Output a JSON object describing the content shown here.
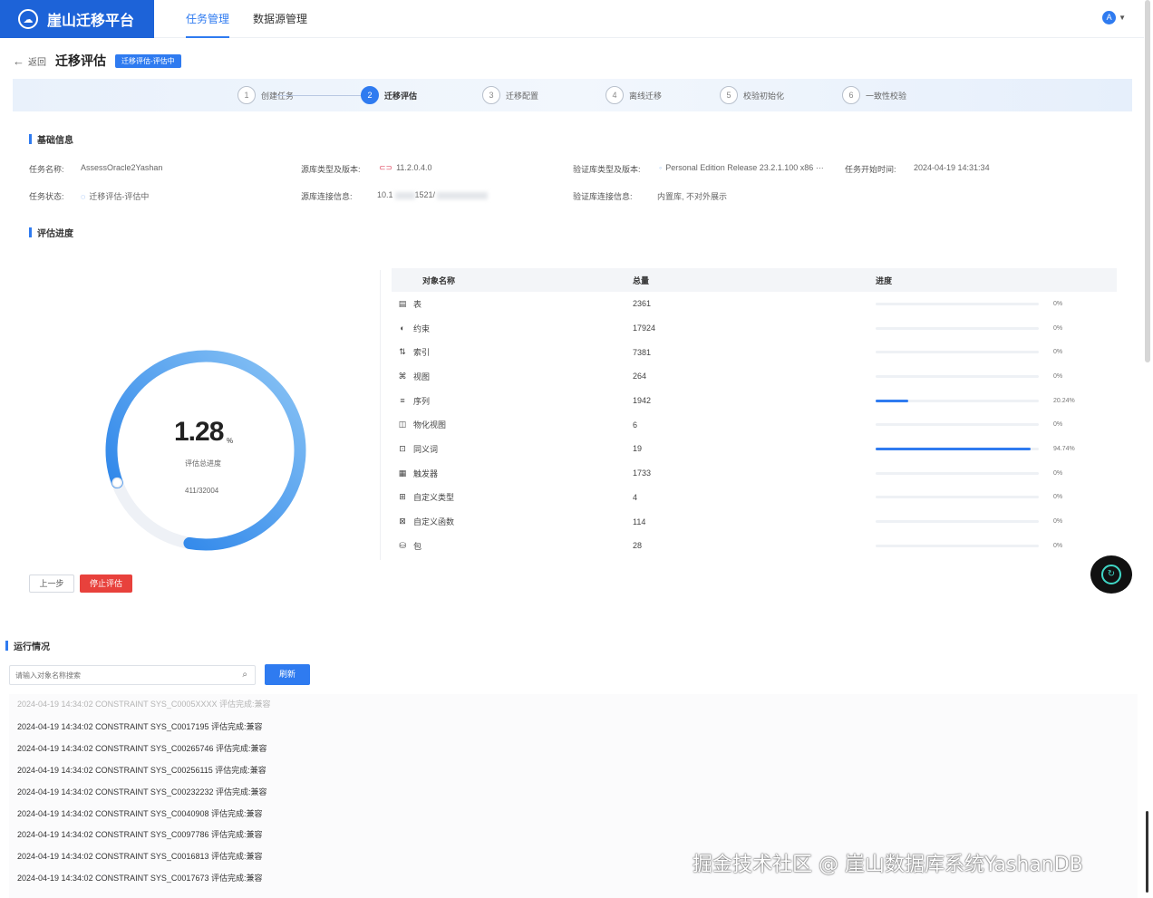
{
  "app": {
    "brand": "崖山迁移平台",
    "nav": [
      "任务管理",
      "数据源管理"
    ],
    "active_nav": 0
  },
  "header": {
    "back_label": "返回",
    "title": "迁移评估",
    "status_tag": "迁移评估-评估中"
  },
  "steps": [
    {
      "num": "1",
      "label": "创建任务"
    },
    {
      "num": "2",
      "label": "迁移评估"
    },
    {
      "num": "3",
      "label": "迁移配置"
    },
    {
      "num": "4",
      "label": "离线迁移"
    },
    {
      "num": "5",
      "label": "校验初始化"
    },
    {
      "num": "6",
      "label": "一致性校验"
    }
  ],
  "active_step": 1,
  "basic_info": {
    "section_title": "基础信息",
    "task_name_label": "任务名称:",
    "task_name": "AssessOracle2Yashan",
    "source_type_label": "源库类型及版本:",
    "source_version": "11.2.0.4.0",
    "target_type_label": "验证库类型及版本:",
    "target_version": "Personal Edition Release 23.2.1.100 x86 ···",
    "start_time_label": "任务开始时间:",
    "start_time": "2024-04-19 14:31:34",
    "task_status_label": "任务状态:",
    "task_status": "迁移评估-评估中",
    "source_conn_label": "源库连接信息:",
    "source_conn": "10.1",
    "source_conn_tail": "1521/",
    "target_conn_label": "验证库连接信息:",
    "target_conn": "内置库, 不对外展示"
  },
  "progress": {
    "section_title": "评估进度",
    "value": "1.28",
    "unit": "%",
    "fraction": 0.0128,
    "caption": "评估总进度",
    "count": "411/32004"
  },
  "table": {
    "headers": [
      "对象名称",
      "总量",
      "进度"
    ],
    "rows": [
      {
        "icon": "table-icon",
        "glyph": "▤",
        "name": "表",
        "total": "2361",
        "pct": 0,
        "pct_label": "0%"
      },
      {
        "icon": "constraint-icon",
        "glyph": "◐",
        "name": "约束",
        "total": "17924",
        "pct": 0,
        "pct_label": "0%"
      },
      {
        "icon": "index-icon",
        "glyph": "⇅",
        "name": "索引",
        "total": "7381",
        "pct": 0,
        "pct_label": "0%"
      },
      {
        "icon": "view-icon",
        "glyph": "⌘",
        "name": "视图",
        "total": "264",
        "pct": 0,
        "pct_label": "0%"
      },
      {
        "icon": "sequence-icon",
        "glyph": "≡",
        "name": "序列",
        "total": "1942",
        "pct": 20.24,
        "pct_label": "20.24%"
      },
      {
        "icon": "mview-icon",
        "glyph": "◫",
        "name": "物化视图",
        "total": "6",
        "pct": 0,
        "pct_label": "0%"
      },
      {
        "icon": "synonym-icon",
        "glyph": "⊡",
        "name": "同义词",
        "total": "19",
        "pct": 94.74,
        "pct_label": "94.74%"
      },
      {
        "icon": "trigger-icon",
        "glyph": "▦",
        "name": "触发器",
        "total": "1733",
        "pct": 0,
        "pct_label": "0%"
      },
      {
        "icon": "custom-type-icon",
        "glyph": "⊞",
        "name": "自定义类型",
        "total": "4",
        "pct": 0,
        "pct_label": "0%"
      },
      {
        "icon": "custom-function-icon",
        "glyph": "⊠",
        "name": "自定义函数",
        "total": "114",
        "pct": 0,
        "pct_label": "0%"
      },
      {
        "icon": "package-icon",
        "glyph": "⛁",
        "name": "包",
        "total": "28",
        "pct": 0,
        "pct_label": "0%"
      }
    ]
  },
  "buttons": {
    "prev": "上一步",
    "stop": "停止评估",
    "search": "刷新"
  },
  "run": {
    "section_title": "运行情况",
    "search_placeholder": "请输入对象名称搜索",
    "logs": [
      "2024-04-19 14:34:02 CONSTRAINT SYS_C0005XXXX 评估完成:兼容",
      "2024-04-19 14:34:02 CONSTRAINT SYS_C0017195 评估完成:兼容",
      "2024-04-19 14:34:02 CONSTRAINT SYS_C00265746 评估完成:兼容",
      "2024-04-19 14:34:02 CONSTRAINT SYS_C00256115 评估完成:兼容",
      "2024-04-19 14:34:02 CONSTRAINT SYS_C00232232 评估完成:兼容",
      "2024-04-19 14:34:02 CONSTRAINT SYS_C0040908 评估完成:兼容",
      "2024-04-19 14:34:02 CONSTRAINT SYS_C0097786 评估完成:兼容",
      "2024-04-19 14:34:02 CONSTRAINT SYS_C0016813 评估完成:兼容",
      "2024-04-19 14:34:02 CONSTRAINT SYS_C0017673 评估完成:兼容"
    ]
  },
  "watermark": "掘金技术社区 @ 崖山数据库系统YashanDB",
  "colors": {
    "accent": "#2f7bf0",
    "danger": "#e8413c",
    "brand": "#1d63d8"
  }
}
